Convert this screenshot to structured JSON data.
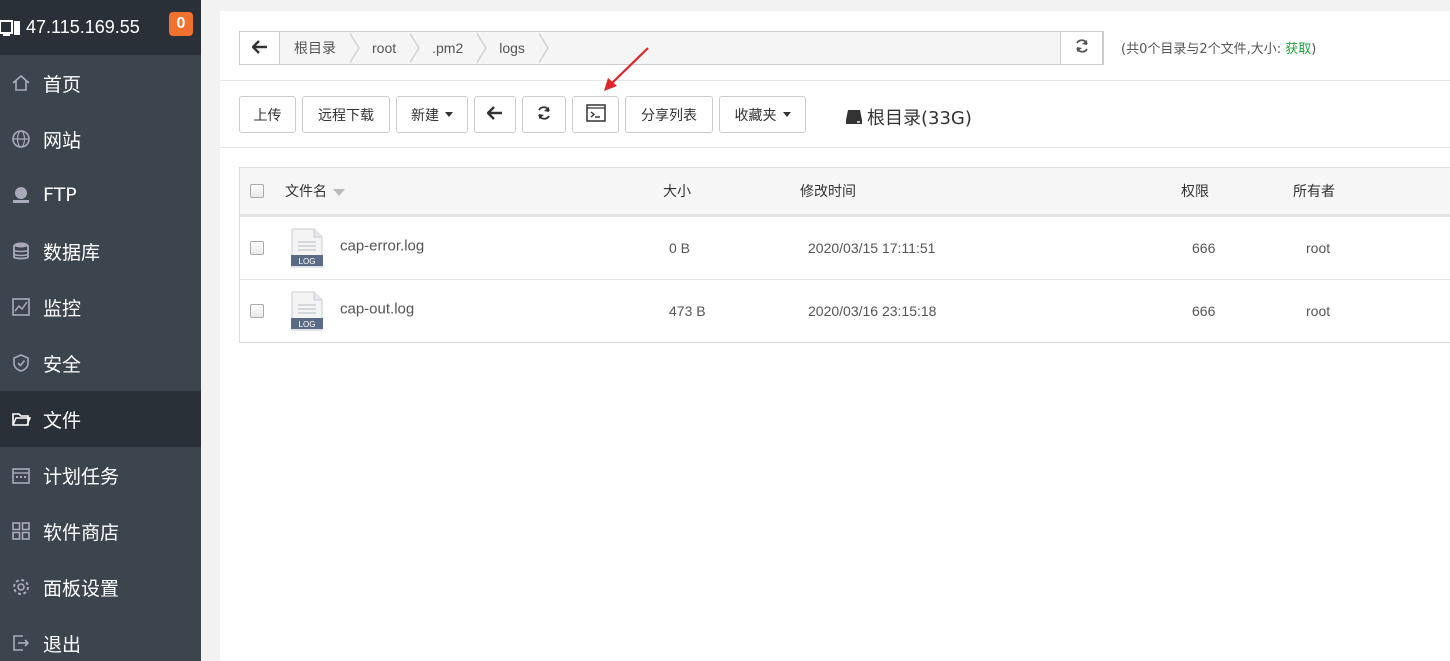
{
  "server": {
    "ip": "47.115.169.55",
    "badge": "0"
  },
  "sidebar": {
    "items": [
      {
        "label": "首页",
        "icon": "home-icon"
      },
      {
        "label": "网站",
        "icon": "globe-icon"
      },
      {
        "label": "FTP",
        "icon": "ftp-icon"
      },
      {
        "label": "数据库",
        "icon": "database-icon"
      },
      {
        "label": "监控",
        "icon": "monitor-icon"
      },
      {
        "label": "安全",
        "icon": "shield-icon"
      },
      {
        "label": "文件",
        "icon": "folder-icon",
        "active": true
      },
      {
        "label": "计划任务",
        "icon": "calendar-icon"
      },
      {
        "label": "软件商店",
        "icon": "apps-icon"
      },
      {
        "label": "面板设置",
        "icon": "gear-icon"
      },
      {
        "label": "退出",
        "icon": "logout-icon"
      }
    ]
  },
  "path": {
    "crumbs": [
      "根目录",
      "root",
      ".pm2",
      "logs"
    ],
    "summary_text": "(共0个目录与2个文件,大小: ",
    "summary_link": "获取",
    "summary_end": ")"
  },
  "toolbar": {
    "upload": "上传",
    "remote_download": "远程下载",
    "new": "新建",
    "share_list": "分享列表",
    "favorites": "收藏夹"
  },
  "disk": {
    "label": "根目录(33G)"
  },
  "table": {
    "headers": {
      "name": "文件名",
      "size": "大小",
      "mtime": "修改时间",
      "perm": "权限",
      "owner": "所有者"
    },
    "rows": [
      {
        "name": "cap-error.log",
        "size": "0 B",
        "mtime": "2020/03/15 17:11:51",
        "perm": "666",
        "owner": "root",
        "icon_label": "LOG"
      },
      {
        "name": "cap-out.log",
        "size": "473 B",
        "mtime": "2020/03/16 23:15:18",
        "perm": "666",
        "owner": "root",
        "icon_label": "LOG"
      }
    ]
  },
  "colors": {
    "sidebar_bg": "#3c444d",
    "sidebar_active": "#2a3037",
    "badge": "#f0712e",
    "link_green": "#20a53a",
    "annotation_red": "#e0262a"
  }
}
